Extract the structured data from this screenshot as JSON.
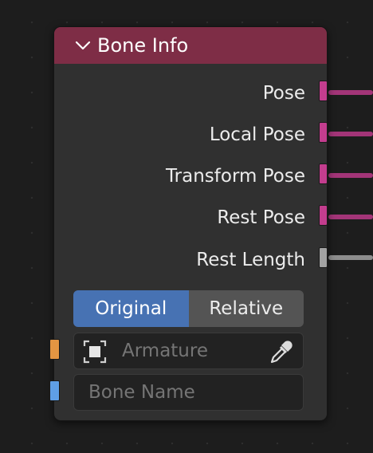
{
  "node": {
    "title": "Bone Info",
    "header_color": "#7e2d46",
    "outputs": [
      {
        "label": "Pose",
        "socket_color": "#c33d8e",
        "link_color": "#a33578"
      },
      {
        "label": "Local Pose",
        "socket_color": "#c33d8e",
        "link_color": "#a33578"
      },
      {
        "label": "Transform Pose",
        "socket_color": "#c33d8e",
        "link_color": "#a33578"
      },
      {
        "label": "Rest Pose",
        "socket_color": "#c33d8e",
        "link_color": "#a33578"
      },
      {
        "label": "Rest Length",
        "socket_color": "#a1a1a1",
        "link_color": "#8d8d8d"
      }
    ],
    "mode": {
      "options": [
        "Original",
        "Relative"
      ],
      "selected": "Original"
    },
    "inputs": {
      "armature": {
        "placeholder": "Armature",
        "socket_color": "#e39542",
        "icon": "object-icon",
        "picker_icon": "eyedropper-icon"
      },
      "bone_name": {
        "placeholder": "Bone Name",
        "socket_color": "#5f9fe6"
      }
    }
  }
}
